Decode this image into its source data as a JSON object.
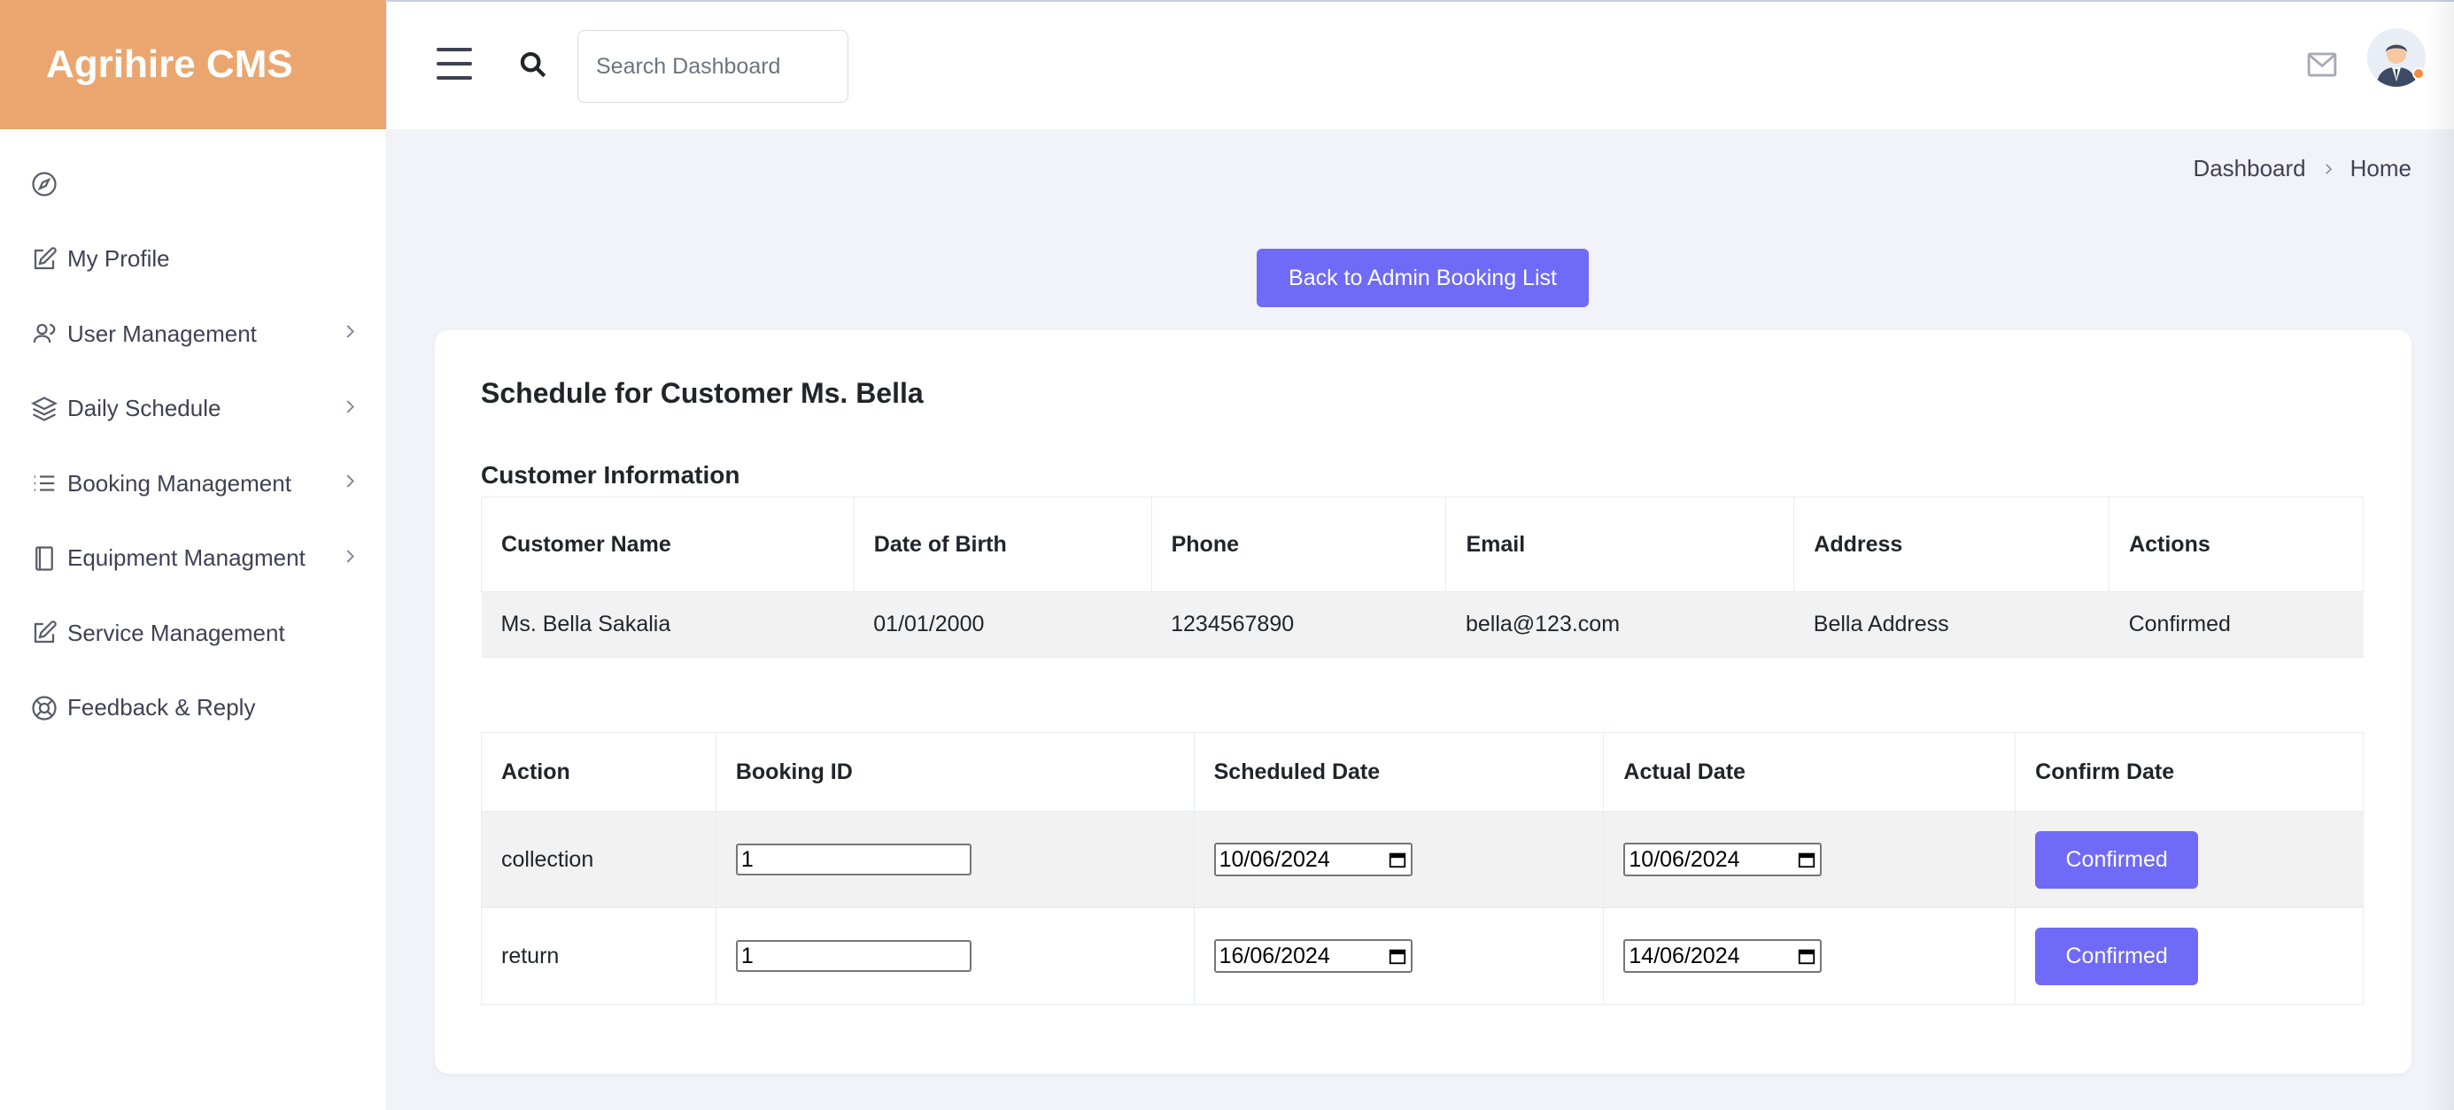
{
  "brand": {
    "title": "Agrihire CMS",
    "color": "#eba66f"
  },
  "sidebar": {
    "items": [
      {
        "label": "",
        "icon": "compass-icon",
        "has_submenu": false
      },
      {
        "label": "My Profile",
        "icon": "edit-icon",
        "has_submenu": false
      },
      {
        "label": "User Management",
        "icon": "user-icon",
        "has_submenu": true
      },
      {
        "label": "Daily Schedule",
        "icon": "layers-icon",
        "has_submenu": true
      },
      {
        "label": "Booking Management",
        "icon": "list-icon",
        "has_submenu": true
      },
      {
        "label": "Equipment Managment",
        "icon": "book-icon",
        "has_submenu": true
      },
      {
        "label": "Service Management",
        "icon": "edit-icon",
        "has_submenu": false
      },
      {
        "label": "Feedback & Reply",
        "icon": "lifebuoy-icon",
        "has_submenu": false
      }
    ]
  },
  "header": {
    "search_placeholder": "Search Dashboard",
    "icons": [
      "menu-icon",
      "search-icon",
      "mail-icon",
      "avatar"
    ]
  },
  "breadcrumb": {
    "items": [
      "Dashboard",
      "Home"
    ]
  },
  "actions": {
    "back_label": "Back to Admin Booking List",
    "accent_color": "#6f6af8"
  },
  "card": {
    "title": "Schedule for Customer Ms. Bella",
    "customer_section_title": "Customer Information"
  },
  "customer_table": {
    "headers": [
      "Customer Name",
      "Date of Birth",
      "Phone",
      "Email",
      "Address",
      "Actions"
    ],
    "row": [
      "Ms. Bella Sakalia",
      "01/01/2000",
      "1234567890",
      "bella@123.com",
      "Bella Address",
      "Confirmed"
    ]
  },
  "schedule_table": {
    "headers": [
      "Action",
      "Booking ID",
      "Scheduled Date",
      "Actual Date",
      "Confirm Date"
    ],
    "rows": [
      {
        "action": "collection",
        "booking_id": "1",
        "scheduled_date": "10/06/2024",
        "actual_date": "10/06/2024",
        "confirm_label": "Confirmed"
      },
      {
        "action": "return",
        "booking_id": "1",
        "scheduled_date": "16/06/2024",
        "actual_date": "14/06/2024",
        "confirm_label": "Confirmed"
      }
    ]
  }
}
